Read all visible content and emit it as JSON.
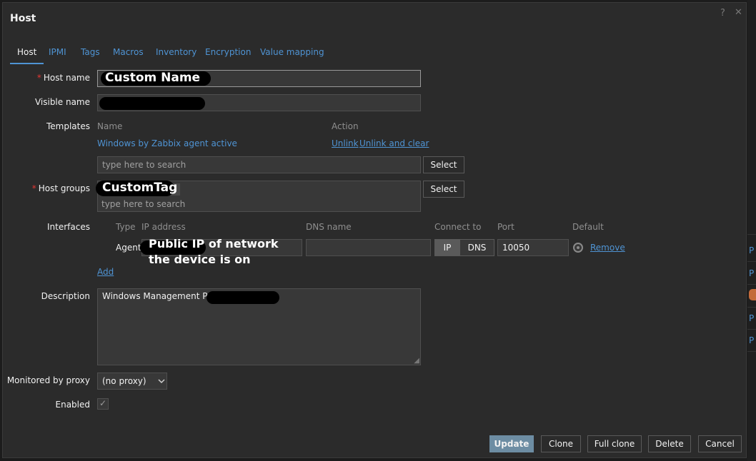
{
  "dialog": {
    "title": "Host",
    "help_icon": "?",
    "close_icon": "✕"
  },
  "tabs": [
    "Host",
    "IPMI",
    "Tags",
    "Macros",
    "Inventory",
    "Encryption",
    "Value mapping"
  ],
  "form": {
    "host_name": {
      "label": "Host name",
      "required_mark": "*",
      "value": "Custom Name"
    },
    "visible_name": {
      "label": "Visible name",
      "value": ""
    },
    "templates": {
      "label": "Templates",
      "col_name": "Name",
      "col_action": "Action",
      "items": [
        {
          "name": "Windows by Zabbix agent active",
          "unlink": "Unlink",
          "unlink_clear": "Unlink and clear"
        }
      ],
      "search_placeholder": "type here to search",
      "select_label": "Select"
    },
    "host_groups": {
      "label": "Host groups",
      "required_mark": "*",
      "chip": "CustomTag",
      "search_placeholder": "type here to search",
      "select_label": "Select"
    },
    "interfaces": {
      "label": "Interfaces",
      "headers": [
        "Type",
        "IP address",
        "DNS name",
        "Connect to",
        "Port",
        "Default"
      ],
      "rows": [
        {
          "type": "Agent",
          "ip_note": "Public IP of network the device is on",
          "dns": "",
          "connect_ip": "IP",
          "connect_dns": "DNS",
          "port": "10050",
          "remove": "Remove"
        }
      ],
      "add_label": "Add"
    },
    "description": {
      "label": "Description",
      "value": "Windows Management PC i"
    },
    "proxy": {
      "label": "Monitored by proxy",
      "selected": "(no proxy)"
    },
    "enabled": {
      "label": "Enabled",
      "checked": true,
      "check_glyph": "✓"
    }
  },
  "footer": {
    "update": "Update",
    "clone": "Clone",
    "full_clone": "Full clone",
    "delete": "Delete",
    "cancel": "Cancel"
  },
  "right_strip": [
    "P",
    "P",
    "P",
    "P",
    "P"
  ],
  "colors": {
    "accent": "#4f94d4",
    "required": "#e33734",
    "primary_button": "#6d8da3"
  }
}
